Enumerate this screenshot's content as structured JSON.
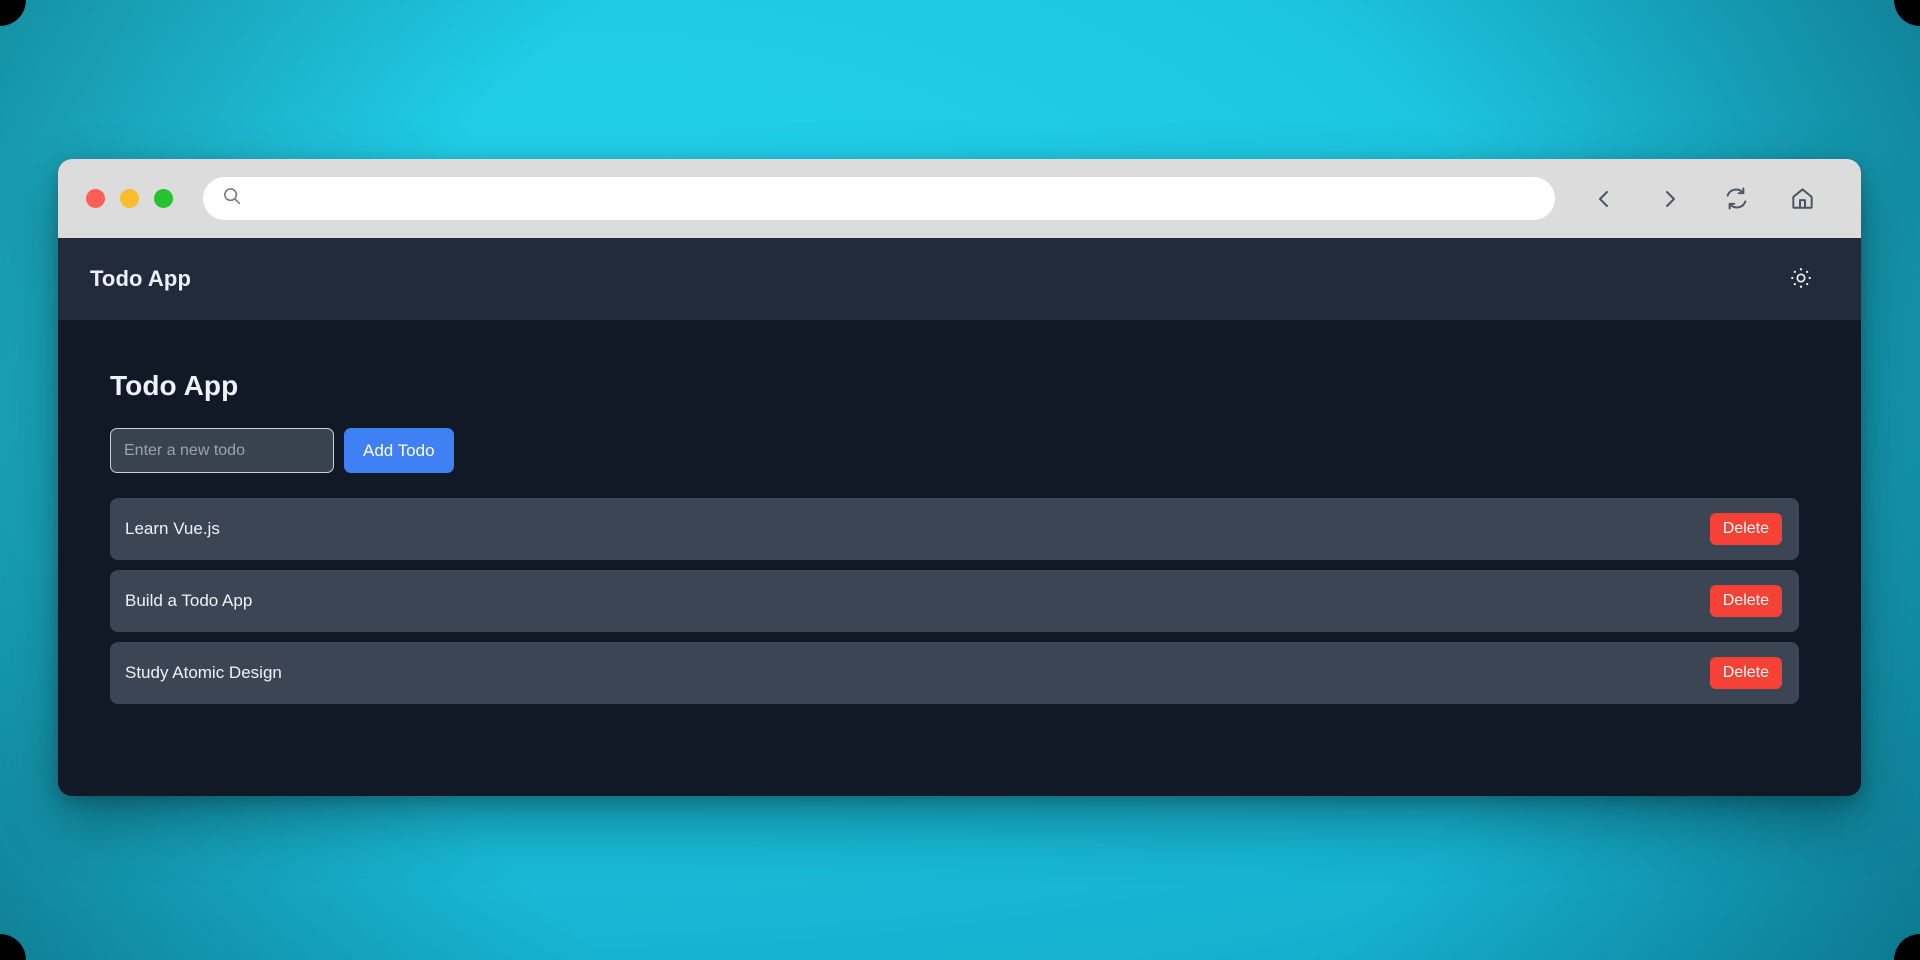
{
  "window": {
    "traffic_lights": [
      {
        "name": "close",
        "color": "#fd5f55"
      },
      {
        "name": "minimize",
        "color": "#f9bd2e"
      },
      {
        "name": "maximize",
        "color": "#25c330"
      }
    ],
    "url_bar": {
      "value": "",
      "placeholder": ""
    },
    "nav": [
      {
        "icon": "back-icon",
        "label": "Back"
      },
      {
        "icon": "forward-icon",
        "label": "Forward"
      },
      {
        "icon": "reload-icon",
        "label": "Reload"
      },
      {
        "icon": "home-icon",
        "label": "Home"
      }
    ]
  },
  "app_header": {
    "title": "Todo App",
    "theme_toggle_icon": "sun-icon"
  },
  "main": {
    "page_title": "Todo App",
    "form": {
      "input_value": "",
      "input_placeholder": "Enter a new todo",
      "add_label": "Add Todo"
    },
    "delete_label": "Delete",
    "todos": [
      {
        "text": "Learn Vue.js"
      },
      {
        "text": "Build a Todo App"
      },
      {
        "text": "Study Atomic Design"
      }
    ]
  },
  "colors": {
    "desktop_accent": "#1ec8e3",
    "chrome_toolbar": "#dcdcdc",
    "app_header_bg": "#212b3b",
    "content_bg": "#121926",
    "todo_item_bg": "#3b4553",
    "primary_button": "#4080f5",
    "danger_button": "#f44336"
  }
}
